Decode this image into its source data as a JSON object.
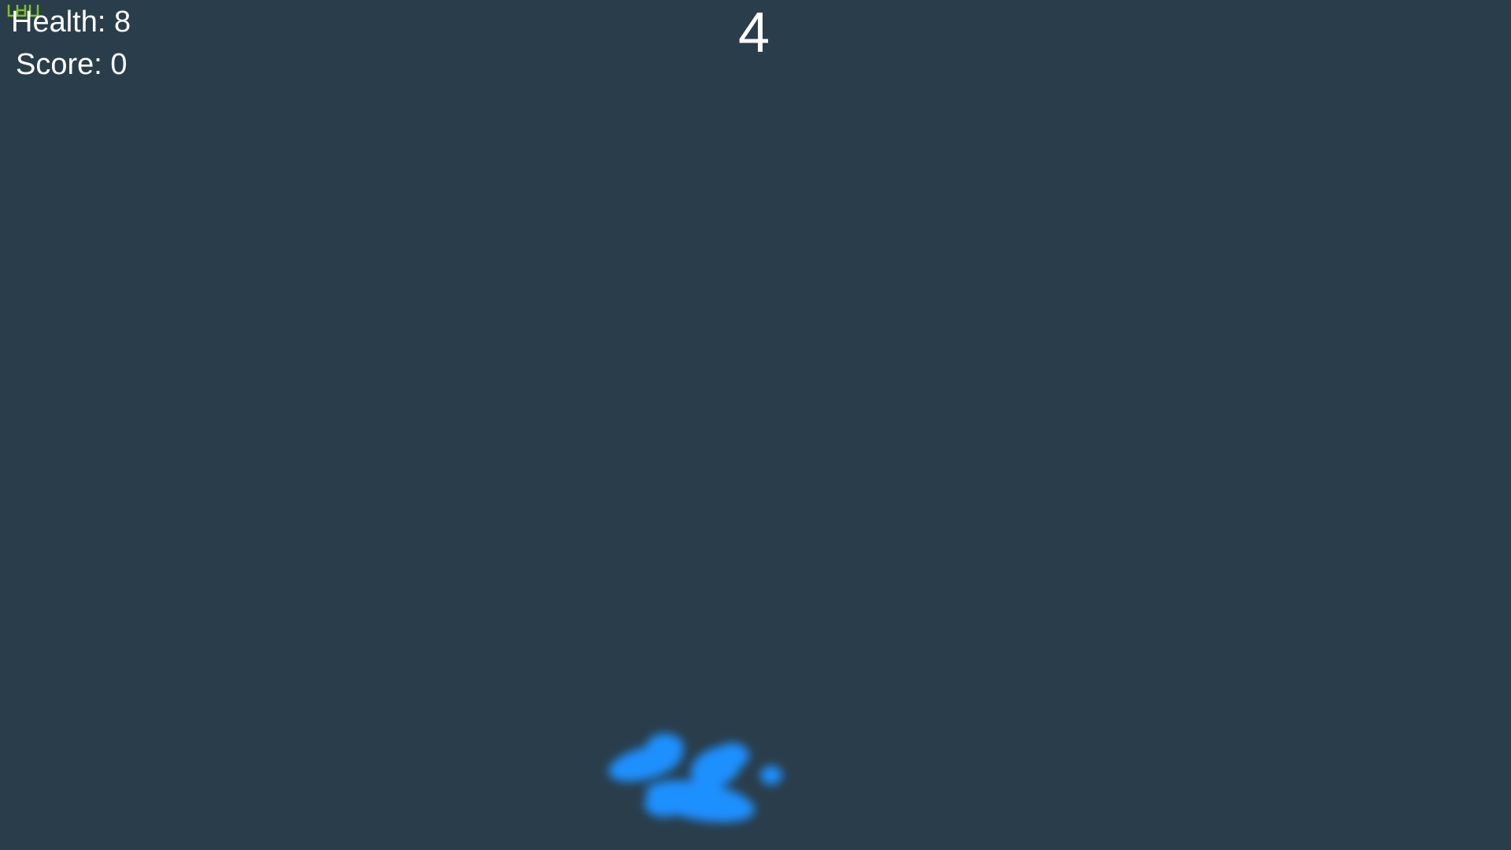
{
  "hud": {
    "health_label": "Health: 8",
    "health_value": 8,
    "score_label": "Score: 0",
    "score_value": 0
  },
  "countdown": {
    "value": "4"
  },
  "fps_meter": {
    "icon": "fps-graph-icon",
    "color": "#7ec321"
  },
  "player": {
    "icon": "player-blob-icon",
    "color": "#1e90ff"
  },
  "colors": {
    "background": "#2a3d4a",
    "text": "#ffffff",
    "accent": "#1e90ff"
  }
}
